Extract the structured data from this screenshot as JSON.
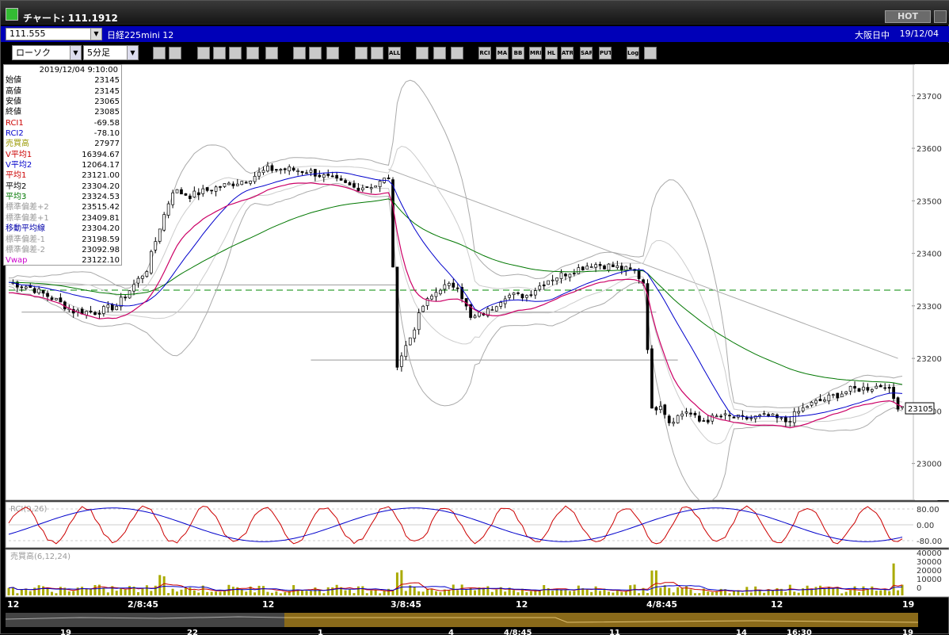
{
  "window": {
    "title": "チャート: 111.1912",
    "hot_label": "HOT"
  },
  "header": {
    "code": "111.555",
    "symbol": "日経225mini 12",
    "exchange": "大阪日中",
    "date": "19/12/04"
  },
  "toolbar": {
    "chart_type": "ローソク",
    "interval": "5分足",
    "buttons": [
      "search",
      "grid",
      "candle",
      "zoom",
      "volume",
      "bar",
      "text",
      "pen",
      "select",
      "undo",
      "left",
      "line",
      "all",
      "settings",
      "tool",
      "color",
      "rci",
      "ma",
      "bb",
      "mre",
      "hl",
      "atr",
      "sar",
      "put",
      "log",
      "exit"
    ],
    "button_labels": {
      "rci": "RCI",
      "ma": "MA",
      "bb": "BB",
      "mre": "MRE",
      "hl": "HL",
      "atr": "ATR",
      "sar": "SAR",
      "put": "PUT",
      "log": "Log",
      "all": "ALL"
    }
  },
  "info": {
    "datetime": "2019/12/04 9:10:00",
    "rows": [
      {
        "label": "始値",
        "value": "23145",
        "color": "#000000"
      },
      {
        "label": "高値",
        "value": "23145",
        "color": "#000000"
      },
      {
        "label": "安値",
        "value": "23065",
        "color": "#000000"
      },
      {
        "label": "終値",
        "value": "23085",
        "color": "#000000"
      },
      {
        "label": "RCI1",
        "value": "-69.58",
        "color": "#cc0000"
      },
      {
        "label": "RCI2",
        "value": "-78.10",
        "color": "#0000cc"
      },
      {
        "label": "売買高",
        "value": "27977",
        "color": "#999900"
      },
      {
        "label": "V平均1",
        "value": "16394.67",
        "color": "#cc0000"
      },
      {
        "label": "V平均2",
        "value": "12064.17",
        "color": "#0000cc"
      },
      {
        "label": "平均1",
        "value": "23121.00",
        "color": "#cc0000"
      },
      {
        "label": "平均2",
        "value": "23304.20",
        "color": "#000000"
      },
      {
        "label": "平均3",
        "value": "23324.53",
        "color": "#007700"
      },
      {
        "label": "標準偏差+2",
        "value": "23515.42",
        "color": "#999999"
      },
      {
        "label": "標準偏差+1",
        "value": "23409.81",
        "color": "#999999"
      },
      {
        "label": "移動平均線",
        "value": "23304.20",
        "color": "#0000aa"
      },
      {
        "label": "標準偏差-1",
        "value": "23198.59",
        "color": "#999999"
      },
      {
        "label": "標準偏差-2",
        "value": "23092.98",
        "color": "#999999"
      },
      {
        "label": "Vwap",
        "value": "23122.10",
        "color": "#cc00cc"
      }
    ]
  },
  "chart_data": [
    {
      "type": "candlestick",
      "ylim": [
        22930,
        23760
      ],
      "y_ticks": [
        23000,
        23100,
        23200,
        23300,
        23400,
        23500,
        23600,
        23700
      ],
      "x_tick_labels": [
        "12",
        "2/8:45",
        "12",
        "3/8:45",
        "12",
        "4/8:45",
        "12",
        "19"
      ],
      "last_price": "23105",
      "h_lines": [
        {
          "value": 23330,
          "style": "dashed",
          "color": "#008800"
        }
      ],
      "close_path": [
        {
          "x": 0,
          "y": 23345
        },
        {
          "x": 5,
          "y": 23335
        },
        {
          "x": 10,
          "y": 23315
        },
        {
          "x": 15,
          "y": 23290
        },
        {
          "x": 20,
          "y": 23288
        },
        {
          "x": 25,
          "y": 23300
        },
        {
          "x": 28,
          "y": 23330
        },
        {
          "x": 32,
          "y": 23370
        },
        {
          "x": 35,
          "y": 23450
        },
        {
          "x": 38,
          "y": 23520
        },
        {
          "x": 42,
          "y": 23510
        },
        {
          "x": 48,
          "y": 23525
        },
        {
          "x": 55,
          "y": 23540
        },
        {
          "x": 60,
          "y": 23560
        },
        {
          "x": 65,
          "y": 23560
        },
        {
          "x": 70,
          "y": 23555
        },
        {
          "x": 75,
          "y": 23540
        },
        {
          "x": 80,
          "y": 23525
        },
        {
          "x": 85,
          "y": 23530
        },
        {
          "x": 88,
          "y": 23545
        },
        {
          "x": 90,
          "y": 23190
        },
        {
          "x": 93,
          "y": 23240
        },
        {
          "x": 96,
          "y": 23300
        },
        {
          "x": 100,
          "y": 23335
        },
        {
          "x": 104,
          "y": 23340
        },
        {
          "x": 107,
          "y": 23275
        },
        {
          "x": 111,
          "y": 23290
        },
        {
          "x": 115,
          "y": 23320
        },
        {
          "x": 120,
          "y": 23320
        },
        {
          "x": 125,
          "y": 23350
        },
        {
          "x": 130,
          "y": 23365
        },
        {
          "x": 135,
          "y": 23380
        },
        {
          "x": 140,
          "y": 23375
        },
        {
          "x": 145,
          "y": 23365
        },
        {
          "x": 147,
          "y": 23345
        },
        {
          "x": 149,
          "y": 23100
        },
        {
          "x": 151,
          "y": 23115
        },
        {
          "x": 153,
          "y": 23080
        },
        {
          "x": 157,
          "y": 23100
        },
        {
          "x": 160,
          "y": 23080
        },
        {
          "x": 165,
          "y": 23090
        },
        {
          "x": 170,
          "y": 23085
        },
        {
          "x": 176,
          "y": 23090
        },
        {
          "x": 180,
          "y": 23080
        },
        {
          "x": 185,
          "y": 23110
        },
        {
          "x": 190,
          "y": 23125
        },
        {
          "x": 195,
          "y": 23140
        },
        {
          "x": 200,
          "y": 23145
        },
        {
          "x": 203,
          "y": 23150
        },
        {
          "x": 206,
          "y": 23110
        }
      ],
      "series": [
        {
          "name": "平均1",
          "color": "#cc0066"
        },
        {
          "name": "移動平均線",
          "color": "#0000cc"
        },
        {
          "name": "平均3",
          "color": "#007700"
        },
        {
          "name": "標準偏差+2",
          "color": "#aaaaaa"
        },
        {
          "name": "標準偏差-2",
          "color": "#aaaaaa"
        }
      ]
    },
    {
      "type": "line",
      "label": "RCI(9,26)",
      "y_ticks": [
        "80.00",
        "0.00",
        "-80.00"
      ],
      "series": [
        {
          "name": "RCI1",
          "color": "#cc0000"
        },
        {
          "name": "RCI2",
          "color": "#0000cc"
        }
      ]
    },
    {
      "type": "bar",
      "label": "売買高(6,12,24)",
      "y_ticks": [
        "40000",
        "30000",
        "20000",
        "10000",
        "0"
      ]
    }
  ],
  "bottom_axis": {
    "labels": [
      "19",
      "22",
      "1",
      "4",
      "4/8:45",
      "11",
      "14",
      "16:30",
      "19"
    ]
  }
}
